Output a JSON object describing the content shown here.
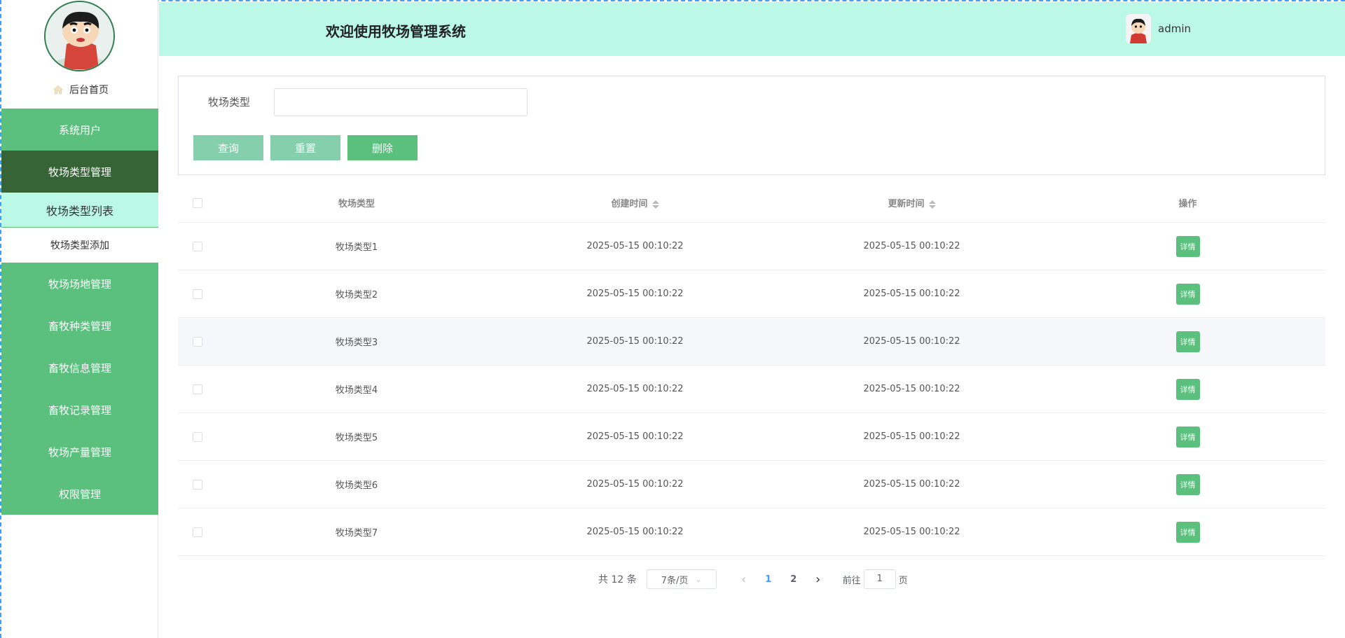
{
  "header": {
    "title": "欢迎使用牧场管理系统",
    "username": "admin"
  },
  "sidebar": {
    "home_label": "后台首页",
    "menu": [
      {
        "label": "系统用户"
      },
      {
        "label": "牧场类型管理"
      },
      {
        "label": "牧场场地管理"
      },
      {
        "label": "畜牧种类管理"
      },
      {
        "label": "畜牧信息管理"
      },
      {
        "label": "畜牧记录管理"
      },
      {
        "label": "牧场产量管理"
      },
      {
        "label": "权限管理"
      }
    ],
    "submenu": [
      {
        "label": "牧场类型列表"
      },
      {
        "label": "牧场类型添加"
      }
    ]
  },
  "search": {
    "label": "牧场类型",
    "value": "",
    "query_label": "查询",
    "reset_label": "重置",
    "delete_label": "删除"
  },
  "table": {
    "columns": [
      "牧场类型",
      "创建时间",
      "更新时间",
      "操作"
    ],
    "detail_label": "详情",
    "rows": [
      {
        "type": "牧场类型1",
        "created": "2025-05-15 00:10:22",
        "updated": "2025-05-15 00:10:22"
      },
      {
        "type": "牧场类型2",
        "created": "2025-05-15 00:10:22",
        "updated": "2025-05-15 00:10:22"
      },
      {
        "type": "牧场类型3",
        "created": "2025-05-15 00:10:22",
        "updated": "2025-05-15 00:10:22"
      },
      {
        "type": "牧场类型4",
        "created": "2025-05-15 00:10:22",
        "updated": "2025-05-15 00:10:22"
      },
      {
        "type": "牧场类型5",
        "created": "2025-05-15 00:10:22",
        "updated": "2025-05-15 00:10:22"
      },
      {
        "type": "牧场类型6",
        "created": "2025-05-15 00:10:22",
        "updated": "2025-05-15 00:10:22"
      },
      {
        "type": "牧场类型7",
        "created": "2025-05-15 00:10:22",
        "updated": "2025-05-15 00:10:22"
      }
    ]
  },
  "pagination": {
    "total": "共 12 条",
    "page_size": "7条/页",
    "pages": [
      "1",
      "2"
    ],
    "current": "1",
    "goto_prefix": "前往",
    "goto_value": "1",
    "goto_suffix": "页"
  },
  "colors": {
    "accent_green": "#5bbf7e",
    "active_dark_green": "#376437",
    "header_mint": "#bbf8e6",
    "pager_active_blue": "#409eff"
  }
}
